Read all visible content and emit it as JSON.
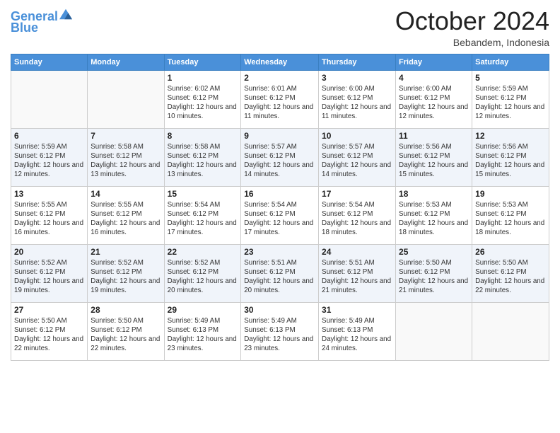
{
  "logo": {
    "line1": "General",
    "line2": "Blue"
  },
  "header": {
    "month": "October 2024",
    "location": "Bebandem, Indonesia"
  },
  "days_of_week": [
    "Sunday",
    "Monday",
    "Tuesday",
    "Wednesday",
    "Thursday",
    "Friday",
    "Saturday"
  ],
  "weeks": [
    [
      {
        "day": "",
        "info": ""
      },
      {
        "day": "",
        "info": ""
      },
      {
        "day": "1",
        "info": "Sunrise: 6:02 AM\nSunset: 6:12 PM\nDaylight: 12 hours and 10 minutes."
      },
      {
        "day": "2",
        "info": "Sunrise: 6:01 AM\nSunset: 6:12 PM\nDaylight: 12 hours and 11 minutes."
      },
      {
        "day": "3",
        "info": "Sunrise: 6:00 AM\nSunset: 6:12 PM\nDaylight: 12 hours and 11 minutes."
      },
      {
        "day": "4",
        "info": "Sunrise: 6:00 AM\nSunset: 6:12 PM\nDaylight: 12 hours and 12 minutes."
      },
      {
        "day": "5",
        "info": "Sunrise: 5:59 AM\nSunset: 6:12 PM\nDaylight: 12 hours and 12 minutes."
      }
    ],
    [
      {
        "day": "6",
        "info": "Sunrise: 5:59 AM\nSunset: 6:12 PM\nDaylight: 12 hours and 12 minutes."
      },
      {
        "day": "7",
        "info": "Sunrise: 5:58 AM\nSunset: 6:12 PM\nDaylight: 12 hours and 13 minutes."
      },
      {
        "day": "8",
        "info": "Sunrise: 5:58 AM\nSunset: 6:12 PM\nDaylight: 12 hours and 13 minutes."
      },
      {
        "day": "9",
        "info": "Sunrise: 5:57 AM\nSunset: 6:12 PM\nDaylight: 12 hours and 14 minutes."
      },
      {
        "day": "10",
        "info": "Sunrise: 5:57 AM\nSunset: 6:12 PM\nDaylight: 12 hours and 14 minutes."
      },
      {
        "day": "11",
        "info": "Sunrise: 5:56 AM\nSunset: 6:12 PM\nDaylight: 12 hours and 15 minutes."
      },
      {
        "day": "12",
        "info": "Sunrise: 5:56 AM\nSunset: 6:12 PM\nDaylight: 12 hours and 15 minutes."
      }
    ],
    [
      {
        "day": "13",
        "info": "Sunrise: 5:55 AM\nSunset: 6:12 PM\nDaylight: 12 hours and 16 minutes."
      },
      {
        "day": "14",
        "info": "Sunrise: 5:55 AM\nSunset: 6:12 PM\nDaylight: 12 hours and 16 minutes."
      },
      {
        "day": "15",
        "info": "Sunrise: 5:54 AM\nSunset: 6:12 PM\nDaylight: 12 hours and 17 minutes."
      },
      {
        "day": "16",
        "info": "Sunrise: 5:54 AM\nSunset: 6:12 PM\nDaylight: 12 hours and 17 minutes."
      },
      {
        "day": "17",
        "info": "Sunrise: 5:54 AM\nSunset: 6:12 PM\nDaylight: 12 hours and 18 minutes."
      },
      {
        "day": "18",
        "info": "Sunrise: 5:53 AM\nSunset: 6:12 PM\nDaylight: 12 hours and 18 minutes."
      },
      {
        "day": "19",
        "info": "Sunrise: 5:53 AM\nSunset: 6:12 PM\nDaylight: 12 hours and 18 minutes."
      }
    ],
    [
      {
        "day": "20",
        "info": "Sunrise: 5:52 AM\nSunset: 6:12 PM\nDaylight: 12 hours and 19 minutes."
      },
      {
        "day": "21",
        "info": "Sunrise: 5:52 AM\nSunset: 6:12 PM\nDaylight: 12 hours and 19 minutes."
      },
      {
        "day": "22",
        "info": "Sunrise: 5:52 AM\nSunset: 6:12 PM\nDaylight: 12 hours and 20 minutes."
      },
      {
        "day": "23",
        "info": "Sunrise: 5:51 AM\nSunset: 6:12 PM\nDaylight: 12 hours and 20 minutes."
      },
      {
        "day": "24",
        "info": "Sunrise: 5:51 AM\nSunset: 6:12 PM\nDaylight: 12 hours and 21 minutes."
      },
      {
        "day": "25",
        "info": "Sunrise: 5:50 AM\nSunset: 6:12 PM\nDaylight: 12 hours and 21 minutes."
      },
      {
        "day": "26",
        "info": "Sunrise: 5:50 AM\nSunset: 6:12 PM\nDaylight: 12 hours and 22 minutes."
      }
    ],
    [
      {
        "day": "27",
        "info": "Sunrise: 5:50 AM\nSunset: 6:12 PM\nDaylight: 12 hours and 22 minutes."
      },
      {
        "day": "28",
        "info": "Sunrise: 5:50 AM\nSunset: 6:12 PM\nDaylight: 12 hours and 22 minutes."
      },
      {
        "day": "29",
        "info": "Sunrise: 5:49 AM\nSunset: 6:13 PM\nDaylight: 12 hours and 23 minutes."
      },
      {
        "day": "30",
        "info": "Sunrise: 5:49 AM\nSunset: 6:13 PM\nDaylight: 12 hours and 23 minutes."
      },
      {
        "day": "31",
        "info": "Sunrise: 5:49 AM\nSunset: 6:13 PM\nDaylight: 12 hours and 24 minutes."
      },
      {
        "day": "",
        "info": ""
      },
      {
        "day": "",
        "info": ""
      }
    ]
  ]
}
